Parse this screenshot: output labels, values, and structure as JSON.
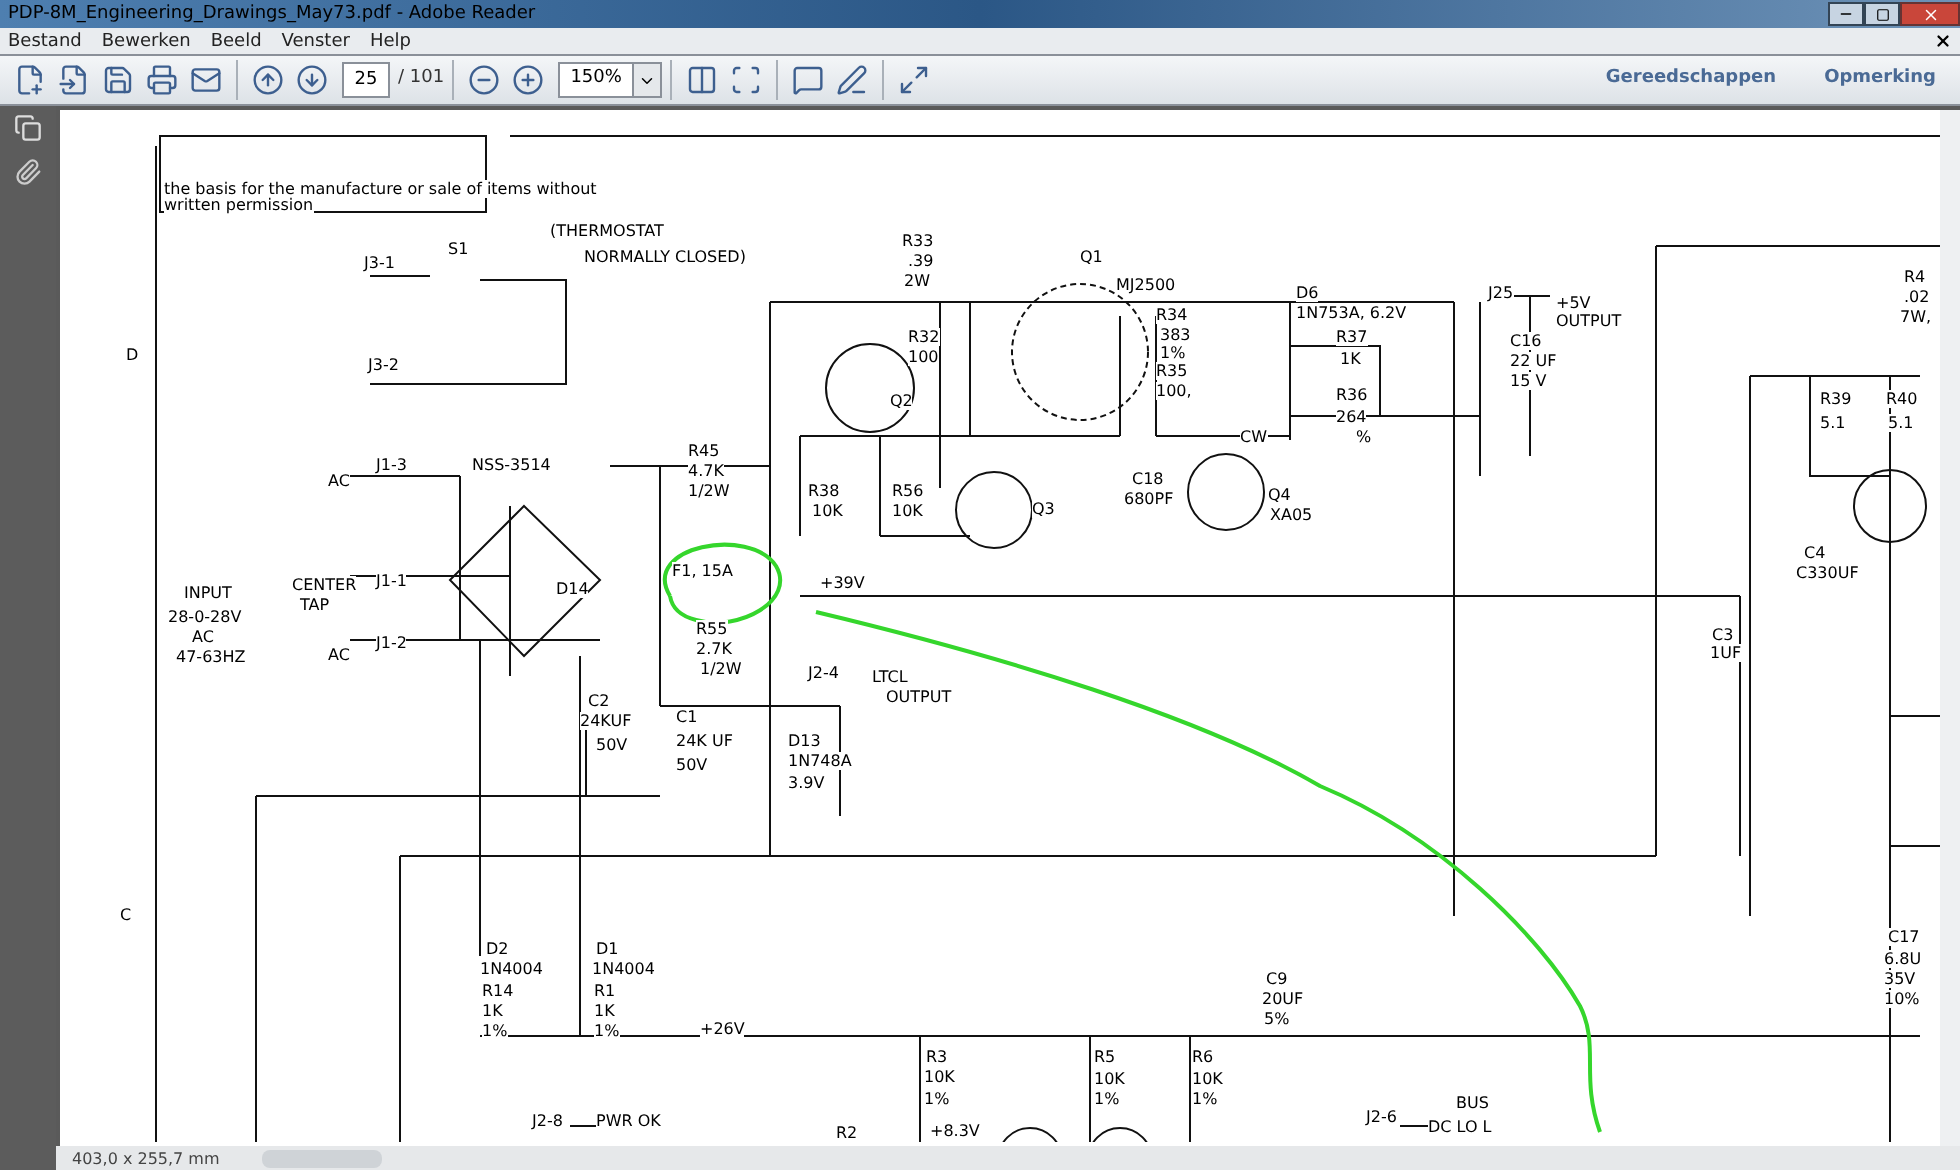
{
  "window": {
    "title": "PDP-8M_Engineering_Drawings_May73.pdf - Adobe Reader"
  },
  "menu": [
    "Bestand",
    "Bewerken",
    "Beeld",
    "Venster",
    "Help"
  ],
  "toolbar": {
    "page": "25",
    "page_count": "/ 101",
    "zoom": "150%",
    "buttons": [
      "Gereedschappen",
      "Opmerking"
    ]
  },
  "schematic": {
    "labels": [
      "the basis for the manufacture or sale of items without",
      "written permission",
      "(THERMOSTAT",
      "NORMALLY CLOSED)",
      "J3-1",
      "S1",
      "J3-2",
      "D",
      "C",
      "R33",
      ".39",
      "2W",
      "R32",
      "100",
      "Q2",
      "Q1",
      "MJ2500",
      "R34",
      "383",
      "1%",
      "R35",
      "100,",
      "CW",
      "D6",
      "1N753A, 6.2V",
      "R37",
      "1K",
      "R36",
      "264",
      "%",
      "J25",
      "+5V",
      "OUTPUT",
      "C16",
      "22 UF",
      "15 V",
      "C18",
      "680PF",
      "Q3",
      "Q4",
      "XA05",
      "R4",
      ".02",
      "7W,",
      "R39",
      "5.1",
      "R40",
      "5.1",
      "C4",
      "C330UF",
      "C3",
      "1UF",
      "R45",
      "4.7K",
      "1/2W",
      "R38",
      "10K",
      "R56",
      "10K",
      "J1-3",
      "NSS-3514",
      "AC",
      "CENTER",
      "J1-1",
      "TAP",
      "INPUT",
      "28-0-28V",
      "AC",
      "47-63HZ",
      "J1-2",
      "AC",
      "D14",
      "F1, 15A",
      "+39V",
      "R55",
      "2.7K",
      "1/2W",
      "J2-4",
      "LTCL",
      "OUTPUT",
      "C2",
      "24KUF",
      "50V",
      "C1",
      "24K UF",
      "50V",
      "D13",
      "1N748A",
      "3.9V",
      "D2",
      "1N4004",
      "R14",
      "1K",
      "1%",
      "D1",
      "1N4004",
      "R1",
      "1K",
      "1%",
      "+26V",
      "R3",
      "10K",
      "1%",
      "R5",
      "10K",
      "1%",
      "R6",
      "10K",
      "1%",
      "C9",
      "20UF",
      "5%",
      "C17",
      "6.8U",
      "35V",
      "10%",
      "J2-8",
      "PWR OK",
      "R2",
      "+8.3V",
      "J2-6",
      "BUS",
      "DC LO L"
    ]
  },
  "status_bar": {
    "page_size": "403,0 x 255,7 mm"
  }
}
